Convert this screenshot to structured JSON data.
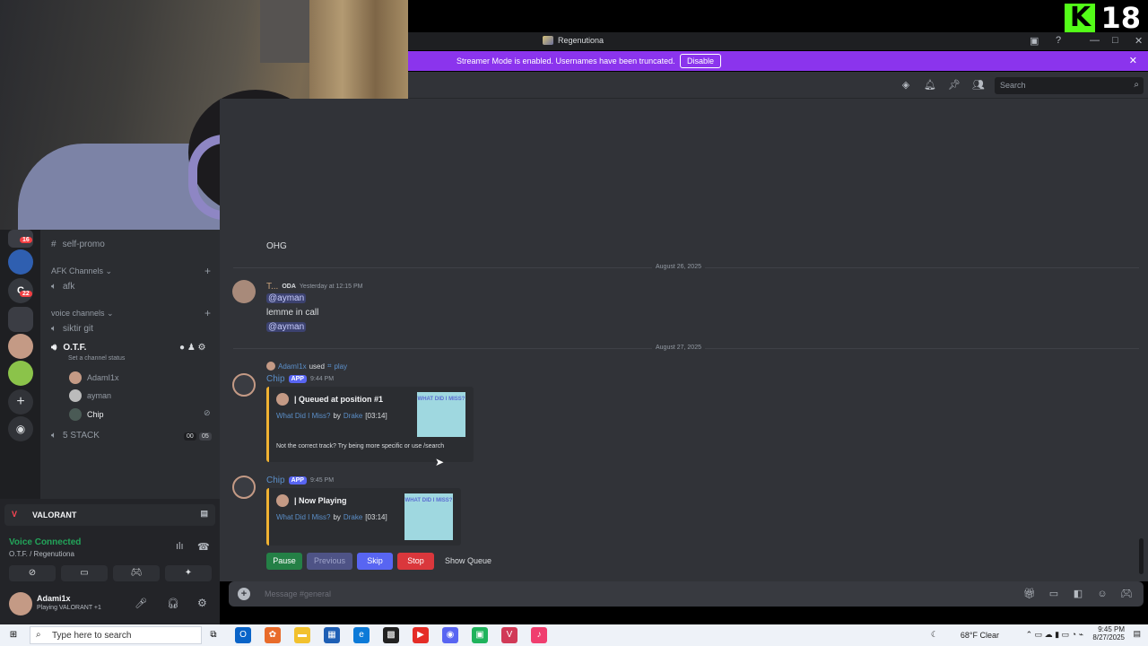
{
  "overlay": {
    "badge_k": "K",
    "badge_num": "18"
  },
  "window": {
    "title": "Regenutiona"
  },
  "streamer_bar": {
    "message": "Streamer Mode is enabled. Usernames have been truncated.",
    "button": "Disable"
  },
  "header": {
    "search_placeholder": "Search"
  },
  "servers": {
    "badge1": "16",
    "badge2": "22"
  },
  "channels": {
    "self_promo": "self-promo",
    "afk_category": "AFK Channels",
    "afk": "afk",
    "voice_category": "voice channels",
    "siktir": "siktir git",
    "otf": "O.T.F.",
    "channel_status": "Set a channel status",
    "users": [
      "AdamI1x",
      "ayman",
      "Chip"
    ],
    "five_stack": "5 STACK",
    "five_count1": "00",
    "five_count2": "05"
  },
  "voice_panel": {
    "game": "VALORANT",
    "connected": "Voice Connected",
    "location": "O.T.F. / Regenutiona"
  },
  "user": {
    "name": "Adami1x",
    "status": "Playing VALORANT +1"
  },
  "chat": {
    "top_text": "OHG",
    "date1": "August 26, 2025",
    "msg1": {
      "author": "T...",
      "tag": "ODA",
      "time": "Yesterday at 12:15 PM",
      "mention1": "@ayman",
      "text": "lemme in call",
      "mention2": "@ayman"
    },
    "date2": "August 27, 2025",
    "used": {
      "user": "AdamI1x",
      "verb": "used",
      "command": "play"
    },
    "msg2": {
      "author": "Chip",
      "app": "APP",
      "time": "9:44 PM",
      "embed_title": "| Queued at position #1",
      "track": "What Did I Miss?",
      "by": "by",
      "artist": "Drake",
      "duration": "[03:14]",
      "footer": "Not the correct track? Try being more specific or use /search",
      "thumb": "WHAT DID I MISS?"
    },
    "msg3": {
      "author": "Chip",
      "app": "APP",
      "time": "9:45 PM",
      "embed_title": "| Now Playing",
      "track": "What Did I Miss?",
      "by": "by",
      "artist": "Drake",
      "duration": "[03:14]",
      "thumb": "WHAT DID I MISS?"
    },
    "buttons": {
      "pause": "Pause",
      "previous": "Previous",
      "skip": "Skip",
      "stop": "Stop",
      "queue": "Show Queue"
    },
    "composer_placeholder": "Message #general"
  },
  "taskbar": {
    "search_placeholder": "Type here to search",
    "weather": "68°F  Clear",
    "time": "9:45 PM",
    "date": "8/27/2025"
  },
  "colors": {
    "brand": "#5865f2",
    "streamer": "#8b34ed",
    "green": "#248046",
    "red": "#da373c"
  }
}
